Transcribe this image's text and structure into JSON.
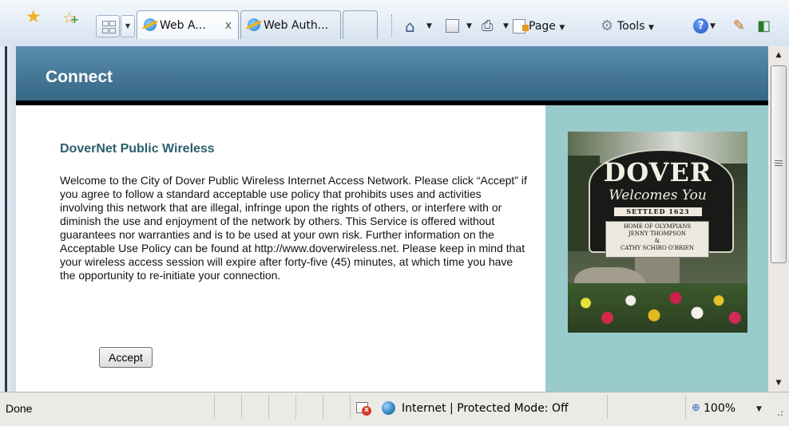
{
  "toolbar": {
    "tabs": [
      {
        "label": "Web A...",
        "close": "x"
      },
      {
        "label": "Web Auth..."
      },
      {
        "label": ""
      }
    ],
    "page_menu": "Page",
    "tools_menu": "Tools",
    "help_label": "?",
    "icons": [
      "favorites-star-icon",
      "add-favorites-icon",
      "quick-tabs-icon",
      "tab-list-icon",
      "internet-explorer-icon",
      "home-icon",
      "feeds-icon",
      "print-icon",
      "page-icon",
      "tools-icon",
      "help-icon",
      "research-icon",
      "translate-icon"
    ]
  },
  "page": {
    "header_title": "Connect",
    "heading": "DoverNet Public Wireless",
    "body": "Welcome to the City of Dover Public Wireless Internet Access Network. Please click “Accept” if you agree to follow a standard acceptable use policy that prohibits uses and activities involving this network that are illegal, infringe upon the rights of others, or interfere with or diminish the use and enjoyment of the network by others. This Service is offered without guarantees nor warranties and is to be used at your own risk. Further information on the Acceptable Use Policy can be found at http://www.doverwireless.net. Please keep in mind that your wireless access session will expire after forty-five (45) minutes, at which time you have the opportunity to re-initiate your connection.",
    "accept_button": "Accept",
    "photo": {
      "title": "DOVER",
      "subtitle": "Welcomes You",
      "settled": "SETTLED 1623",
      "plaque_line1": "HOME OF OLYMPIANS",
      "plaque_line2": "JENNY THOMPSON",
      "plaque_line3": "&",
      "plaque_line4": "CATHY SCHIRO O'BRIEN"
    },
    "colors": {
      "header_band": "#477998",
      "side_panel": "#99cbcc",
      "heading": "#2c5f6e"
    }
  },
  "status": {
    "text": "Done",
    "zone": "Internet | Protected Mode: Off",
    "zoom": "100%"
  }
}
